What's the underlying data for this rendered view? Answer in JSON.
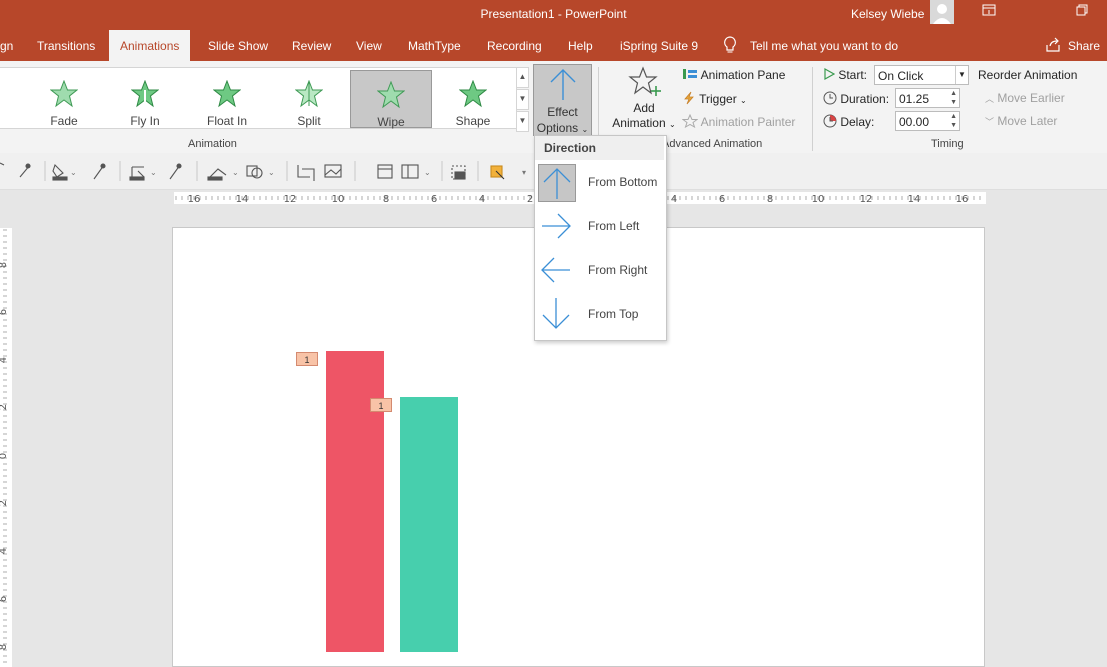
{
  "window": {
    "title": "Presentation1  -  PowerPoint",
    "user": "Kelsey Wiebe"
  },
  "tabs": [
    {
      "label": "gn"
    },
    {
      "label": "Transitions"
    },
    {
      "label": "Animations"
    },
    {
      "label": "Slide Show"
    },
    {
      "label": "Review"
    },
    {
      "label": "View"
    },
    {
      "label": "MathType"
    },
    {
      "label": "Recording"
    },
    {
      "label": "Help"
    },
    {
      "label": "iSpring Suite 9"
    }
  ],
  "tell_me": "Tell me what you want to do",
  "share": "Share",
  "animation_gallery": {
    "items": [
      {
        "label": "Fade"
      },
      {
        "label": "Fly In"
      },
      {
        "label": "Float In"
      },
      {
        "label": "Split"
      },
      {
        "label": "Wipe"
      },
      {
        "label": "Shape"
      }
    ],
    "group_label": "Animation"
  },
  "effect_options": {
    "line1": "Effect",
    "line2": "Options"
  },
  "advanced": {
    "add_line1": "Add",
    "add_line2": "Animation",
    "pane": "Animation Pane",
    "trigger": "Trigger",
    "painter": "Animation Painter",
    "group_label": "Advanced Animation"
  },
  "timing": {
    "start_label": "Start:",
    "start_value": "On Click",
    "duration_label": "Duration:",
    "duration_value": "01.25",
    "delay_label": "Delay:",
    "delay_value": "00.00",
    "reorder": "Reorder Animation",
    "earlier": "Move Earlier",
    "later": "Move Later",
    "group_label": "Timing"
  },
  "ruler": {
    "h_left": [
      "16",
      "14",
      "12",
      "10",
      "8",
      "6",
      "4",
      "2"
    ],
    "h_right": [
      "4",
      "6",
      "8",
      "10",
      "12",
      "14",
      "16"
    ],
    "v": [
      "8",
      "6",
      "4",
      "2",
      "0",
      "2",
      "4",
      "6",
      "8"
    ]
  },
  "dropdown": {
    "header": "Direction",
    "items": [
      {
        "label": "From Bottom",
        "icon": "arrow-up-icon"
      },
      {
        "label": "From Left",
        "icon": "arrow-right-icon"
      },
      {
        "label": "From Right",
        "icon": "arrow-left-icon"
      },
      {
        "label": "From Top",
        "icon": "arrow-down-icon"
      }
    ]
  },
  "slide": {
    "tag_1": "1",
    "tag_2": "1",
    "colors": {
      "red_bar": "#ee5566",
      "teal_bar": "#47cfad"
    }
  }
}
